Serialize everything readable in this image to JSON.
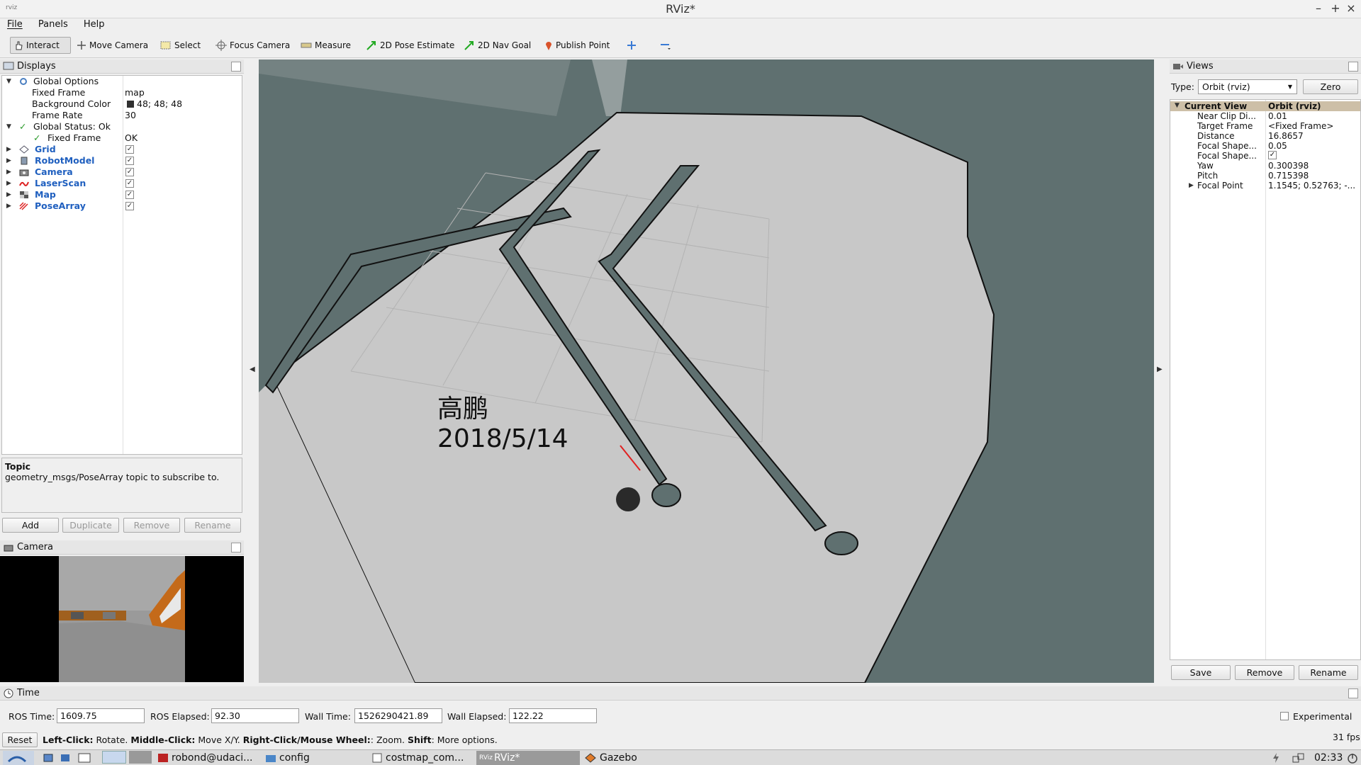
{
  "window": {
    "title": "RViz*"
  },
  "menu": [
    "File",
    "Panels",
    "Help"
  ],
  "toolbar": {
    "tools": [
      "Interact",
      "Move Camera",
      "Select",
      "Focus Camera",
      "Measure",
      "2D Pose Estimate",
      "2D Nav Goal",
      "Publish Point"
    ]
  },
  "displays": {
    "title": "Displays",
    "global_options": "Global Options",
    "fixed_frame_label": "Fixed Frame",
    "fixed_frame_value": "map",
    "bg_color_label": "Background Color",
    "bg_color_value": "48; 48; 48",
    "frame_rate_label": "Frame Rate",
    "frame_rate_value": "30",
    "global_status": "Global Status: Ok",
    "status_fixed_frame_label": "Fixed Frame",
    "status_fixed_frame_value": "OK",
    "items": [
      {
        "label": "Grid",
        "checked": true,
        "icon": "grid-icon"
      },
      {
        "label": "RobotModel",
        "checked": true,
        "icon": "robot-icon"
      },
      {
        "label": "Camera",
        "checked": true,
        "icon": "camera-icon"
      },
      {
        "label": "LaserScan",
        "checked": true,
        "icon": "laser-icon"
      },
      {
        "label": "Map",
        "checked": true,
        "icon": "map-icon"
      },
      {
        "label": "PoseArray",
        "checked": true,
        "icon": "pose-array-icon"
      }
    ],
    "help_title": "Topic",
    "help_text": "geometry_msgs/PoseArray topic to subscribe to.",
    "buttons": {
      "add": "Add",
      "duplicate": "Duplicate",
      "remove": "Remove",
      "rename": "Rename"
    }
  },
  "camera_panel": {
    "title": "Camera"
  },
  "viewport": {
    "overlay_name": "高鹏",
    "overlay_date": "2018/5/14"
  },
  "views": {
    "title": "Views",
    "type_label": "Type:",
    "type_value": "Orbit (rviz)",
    "zero_label": "Zero",
    "current_view_label": "Current View",
    "current_view_value": "Orbit (rviz)",
    "rows": [
      {
        "label": "Near Clip Di...",
        "value": "0.01"
      },
      {
        "label": "Target Frame",
        "value": "<Fixed Frame>"
      },
      {
        "label": "Distance",
        "value": "16.8657"
      },
      {
        "label": "Focal Shape...",
        "value": "0.05"
      },
      {
        "label": "Focal Shape...",
        "value": "✓"
      },
      {
        "label": "Yaw",
        "value": "0.300398"
      },
      {
        "label": "Pitch",
        "value": "0.715398"
      },
      {
        "label": "Focal Point",
        "value": "1.1545; 0.52763; -..."
      }
    ],
    "buttons": {
      "save": "Save",
      "remove": "Remove",
      "rename": "Rename"
    }
  },
  "time_panel": {
    "title": "Time",
    "ros_time_label": "ROS Time:",
    "ros_time": "1609.75",
    "ros_elapsed_label": "ROS Elapsed:",
    "ros_elapsed": "92.30",
    "wall_time_label": "Wall Time:",
    "wall_time": "1526290421.89",
    "wall_elapsed_label": "Wall Elapsed:",
    "wall_elapsed": "122.22",
    "experimental_label": "Experimental"
  },
  "statusbar": {
    "reset_label": "Reset",
    "hint_b1": "Left-Click:",
    "hint_t1": " Rotate. ",
    "hint_b2": "Middle-Click:",
    "hint_t2": " Move X/Y. ",
    "hint_b3": "Right-Click/Mouse Wheel:",
    "hint_t3": ": Zoom. ",
    "hint_b4": "Shift",
    "hint_t4": ": More options.",
    "fps": "31 fps"
  },
  "taskbar": {
    "items": [
      "robond@udaci...",
      "config",
      "costmap_com...",
      "RViz*",
      "Gazebo"
    ],
    "clock": "02:33"
  },
  "colors": {
    "map_free": "#c8c8c8",
    "map_unknown": "#5f7070",
    "accent_blue": "#1f5fbf"
  }
}
